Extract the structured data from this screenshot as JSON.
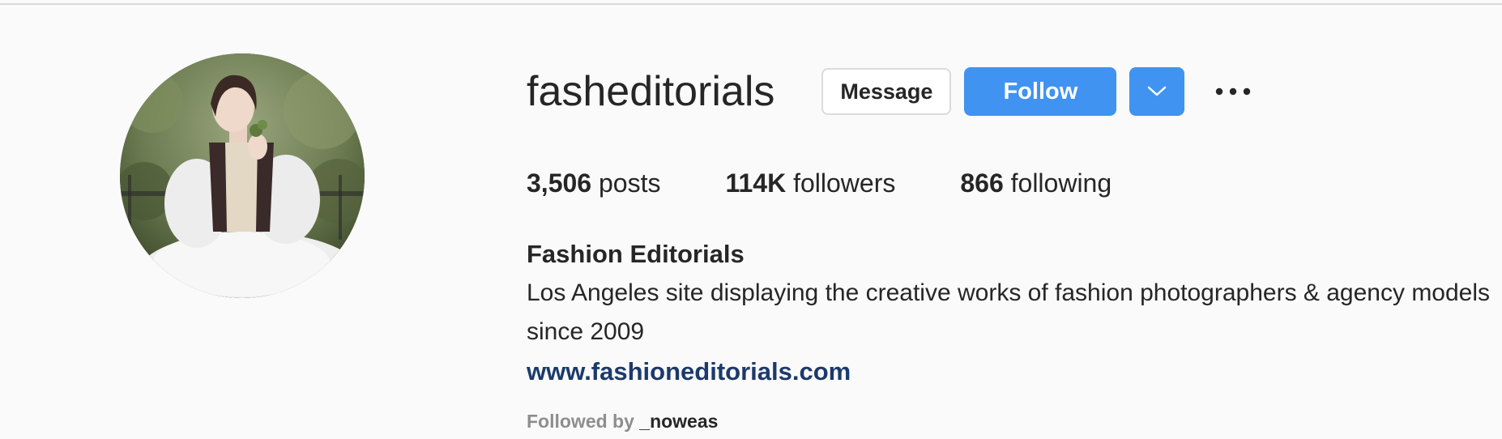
{
  "profile": {
    "username": "fasheditorials",
    "buttons": {
      "message_label": "Message",
      "follow_label": "Follow"
    },
    "stats": [
      {
        "value": "3,506",
        "label": "posts"
      },
      {
        "value": "114K",
        "label": "followers"
      },
      {
        "value": "866",
        "label": "following"
      }
    ],
    "full_name": "Fashion Editorials",
    "bio": "Los Angeles site displaying the creative works of fashion photographers & agency models since 2009",
    "website": "www.fashioneditorials.com",
    "followed_by": {
      "prefix": "Followed by",
      "user": "_noweas"
    },
    "icons": {
      "dropdown": "chevron-down-icon",
      "more": "more-options-icon"
    },
    "colors": {
      "follow_button": "#4093f0",
      "link": "#1c3a6b",
      "background": "#fafafa"
    }
  }
}
